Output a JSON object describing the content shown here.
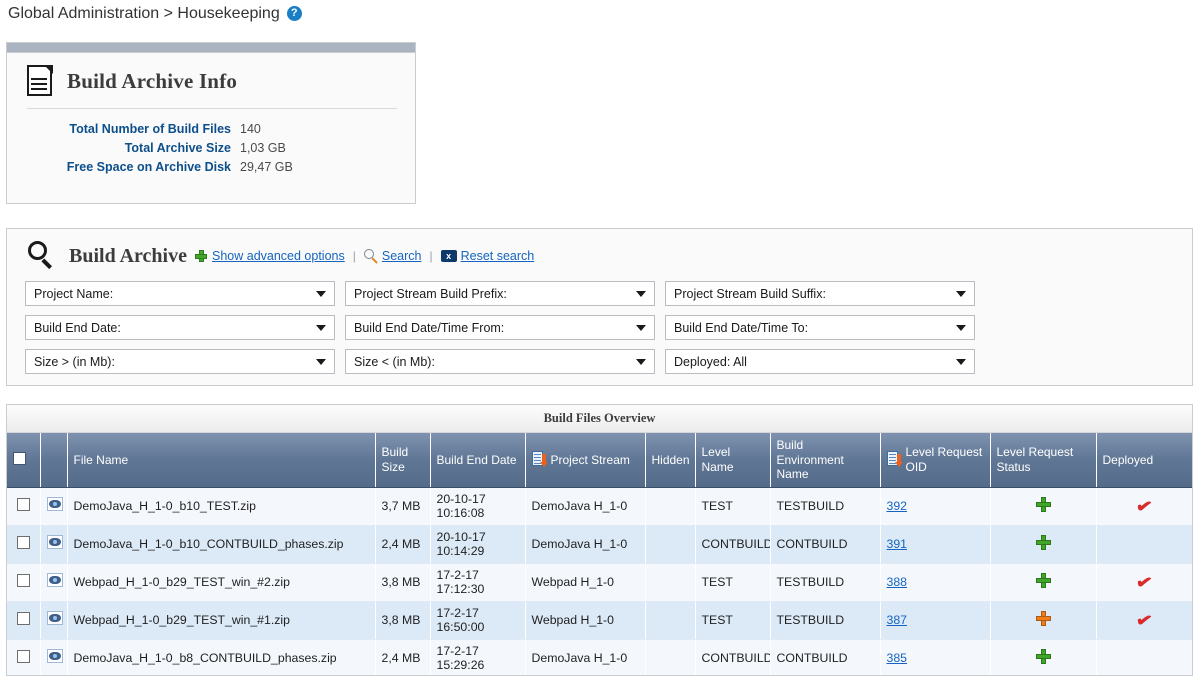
{
  "breadcrumb": {
    "text": "Global Administration > Housekeeping",
    "help_icon": "help-icon",
    "help_glyph": "?"
  },
  "archive_info": {
    "title": "Build Archive Info",
    "icon": "document-icon",
    "rows": [
      {
        "label": "Total Number of Build Files",
        "value": "140"
      },
      {
        "label": "Total Archive Size",
        "value": "1,03 GB"
      },
      {
        "label": "Free Space on Archive Disk",
        "value": "29,47 GB"
      }
    ]
  },
  "search": {
    "title": "Build Archive",
    "icon": "magnifier-icon",
    "links": [
      {
        "label": "Show advanced options",
        "icon": "plus-green-icon"
      },
      {
        "label": "Search",
        "icon": "magnifier-small-icon"
      },
      {
        "label": "Reset search",
        "icon": "reset-icon"
      }
    ],
    "separator": "|",
    "reset_glyph": "x",
    "filters": [
      {
        "label": "Project Name:"
      },
      {
        "label": "Project Stream Build Prefix:"
      },
      {
        "label": "Project Stream Build Suffix:"
      },
      {
        "label": "Build End Date:"
      },
      {
        "label": "Build End Date/Time From:"
      },
      {
        "label": "Build End Date/Time To:"
      },
      {
        "label": "Size > (in Mb):"
      },
      {
        "label": "Size < (in Mb):"
      },
      {
        "label": "Deployed: All"
      }
    ]
  },
  "files_table": {
    "caption": "Build Files Overview",
    "columns": [
      {
        "label": "",
        "name": "select-all-column",
        "sortable": false
      },
      {
        "label": "",
        "name": "view-column",
        "sortable": false
      },
      {
        "label": "File Name",
        "name": "file-name-column",
        "sortable": false
      },
      {
        "label": "Build Size",
        "name": "build-size-column",
        "sortable": false
      },
      {
        "label": "Build End Date",
        "name": "build-end-date-column",
        "sortable": false
      },
      {
        "label": "Project Stream",
        "name": "project-stream-column",
        "sortable": true
      },
      {
        "label": "Hidden",
        "name": "hidden-column",
        "sortable": false
      },
      {
        "label": "Level Name",
        "name": "level-name-column",
        "sortable": false
      },
      {
        "label": "Build Environment Name",
        "name": "build-environment-name-column",
        "sortable": false
      },
      {
        "label": "Level Request OID",
        "name": "level-request-oid-column",
        "sortable": true
      },
      {
        "label": "Level Request Status",
        "name": "level-request-status-column",
        "sortable": false
      },
      {
        "label": "Deployed",
        "name": "deployed-column",
        "sortable": false
      }
    ],
    "rows": [
      {
        "file_name": "DemoJava_H_1-0_b10_TEST.zip",
        "build_size": "3,7 MB",
        "build_end_date": "20-10-17",
        "build_end_time": "10:16:08",
        "project_stream": "DemoJava H_1-0",
        "hidden": "",
        "level_name": "TEST",
        "build_environment_name": "TESTBUILD",
        "level_request_oid": "392",
        "level_request_status": "green",
        "deployed": true
      },
      {
        "file_name": "DemoJava_H_1-0_b10_CONTBUILD_phases.zip",
        "build_size": "2,4 MB",
        "build_end_date": "20-10-17",
        "build_end_time": "10:14:29",
        "project_stream": "DemoJava H_1-0",
        "hidden": "",
        "level_name": "CONTBUILD",
        "build_environment_name": "CONTBUILD",
        "level_request_oid": "391",
        "level_request_status": "green",
        "deployed": false
      },
      {
        "file_name": "Webpad_H_1-0_b29_TEST_win_#2.zip",
        "build_size": "3,8 MB",
        "build_end_date": "17-2-17",
        "build_end_time": "17:12:30",
        "project_stream": "Webpad H_1-0",
        "hidden": "",
        "level_name": "TEST",
        "build_environment_name": "TESTBUILD",
        "level_request_oid": "388",
        "level_request_status": "green",
        "deployed": true
      },
      {
        "file_name": "Webpad_H_1-0_b29_TEST_win_#1.zip",
        "build_size": "3,8 MB",
        "build_end_date": "17-2-17",
        "build_end_time": "16:50:00",
        "project_stream": "Webpad H_1-0",
        "hidden": "",
        "level_name": "TEST",
        "build_environment_name": "TESTBUILD",
        "level_request_oid": "387",
        "level_request_status": "orange",
        "deployed": true
      },
      {
        "file_name": "DemoJava_H_1-0_b8_CONTBUILD_phases.zip",
        "build_size": "2,4 MB",
        "build_end_date": "17-2-17",
        "build_end_time": "15:29:26",
        "project_stream": "DemoJava H_1-0",
        "hidden": "",
        "level_name": "CONTBUILD",
        "build_environment_name": "CONTBUILD",
        "level_request_oid": "385",
        "level_request_status": "green",
        "deployed": false
      }
    ],
    "deployed_glyph": "✔"
  },
  "colors": {
    "link": "#1565c0",
    "header_blue": "#5f7694",
    "label_blue": "#0d4f8b",
    "status_green": "#40a629",
    "status_orange": "#f07d1a",
    "deployed_red": "#d92b2b"
  }
}
